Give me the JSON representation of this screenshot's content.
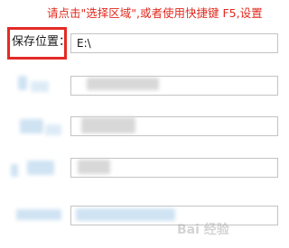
{
  "hint": {
    "text": "请点击\"选择区域\",或者使用快捷键 F5,设置"
  },
  "save_location": {
    "label": "保存位置：",
    "value": "E:\\"
  },
  "watermark": {
    "text": "Bai 经验"
  },
  "colors": {
    "hint_red": "#e0291e",
    "highlight_border": "#e42a26",
    "field_border": "#c3c3c3"
  }
}
